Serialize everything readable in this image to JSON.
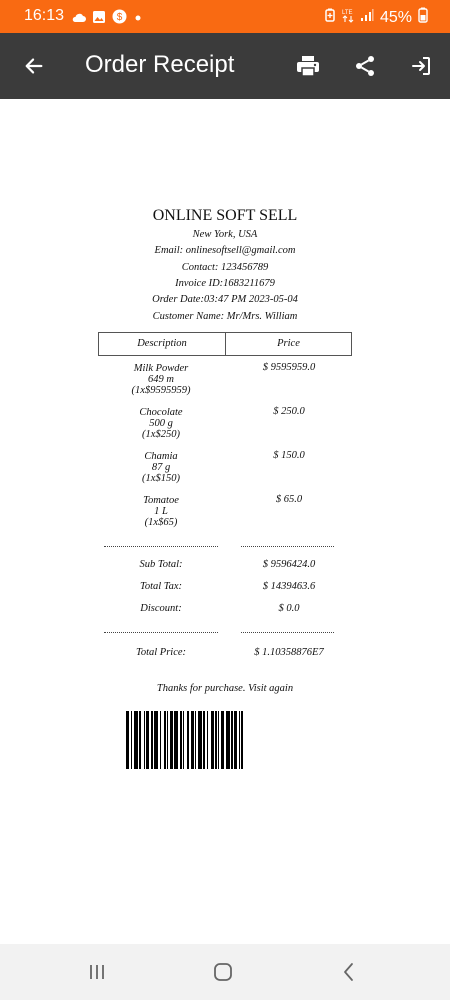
{
  "status_bar": {
    "time": "16:13",
    "battery": "45%",
    "icons_left": [
      "cloud-icon",
      "image-icon",
      "s-app-icon",
      "dot-icon"
    ],
    "icons_right": [
      "battery-saver-icon",
      "data-icon",
      "signal-icon",
      "battery-icon"
    ]
  },
  "app_bar": {
    "title": "Order Receipt",
    "back_icon": "arrow-left-icon",
    "actions": [
      "print-icon",
      "share-icon",
      "exit-icon"
    ]
  },
  "receipt": {
    "shop_name": "ONLINE SOFT SELL",
    "location": "New York, USA",
    "email": "Email: onlinesoftsell@gmail.com",
    "contact": "Contact: 123456789",
    "invoice": "Invoice ID:1683211679",
    "order_date": "Order Date:03:47 PM 2023-05-04",
    "customer": "Customer Name: Mr/Mrs. William",
    "table_headers": {
      "description": "Description",
      "price": "Price"
    },
    "items": [
      {
        "name": "Milk Powder",
        "qty": "649 m",
        "calc": "(1x$9595959)",
        "price": "$ 9595959.0"
      },
      {
        "name": "Chocolate",
        "qty": "500 g",
        "calc": "(1x$250)",
        "price": "$ 250.0"
      },
      {
        "name": "Chamia",
        "qty": "87 g",
        "calc": "(1x$150)",
        "price": "$ 150.0"
      },
      {
        "name": "Tomatoe",
        "qty": "1 L",
        "calc": "(1x$65)",
        "price": "$ 65.0"
      }
    ],
    "summary": {
      "subtotal_label": "Sub Total:",
      "subtotal": "$ 9596424.0",
      "tax_label": "Total Tax:",
      "tax": "$ 1439463.6",
      "discount_label": "Discount:",
      "discount": "$ 0.0",
      "total_label": "Total Price:",
      "total": "$ 1.10358876E7"
    },
    "thanks": "Thanks for purchase. Visit again"
  },
  "nav_bar": {
    "buttons": [
      "recents-icon",
      "home-icon",
      "back-icon"
    ]
  },
  "colors": {
    "status_bar": "#f96a12",
    "app_bar": "#3b3b3b",
    "nav_bar": "#f2f2f2"
  }
}
